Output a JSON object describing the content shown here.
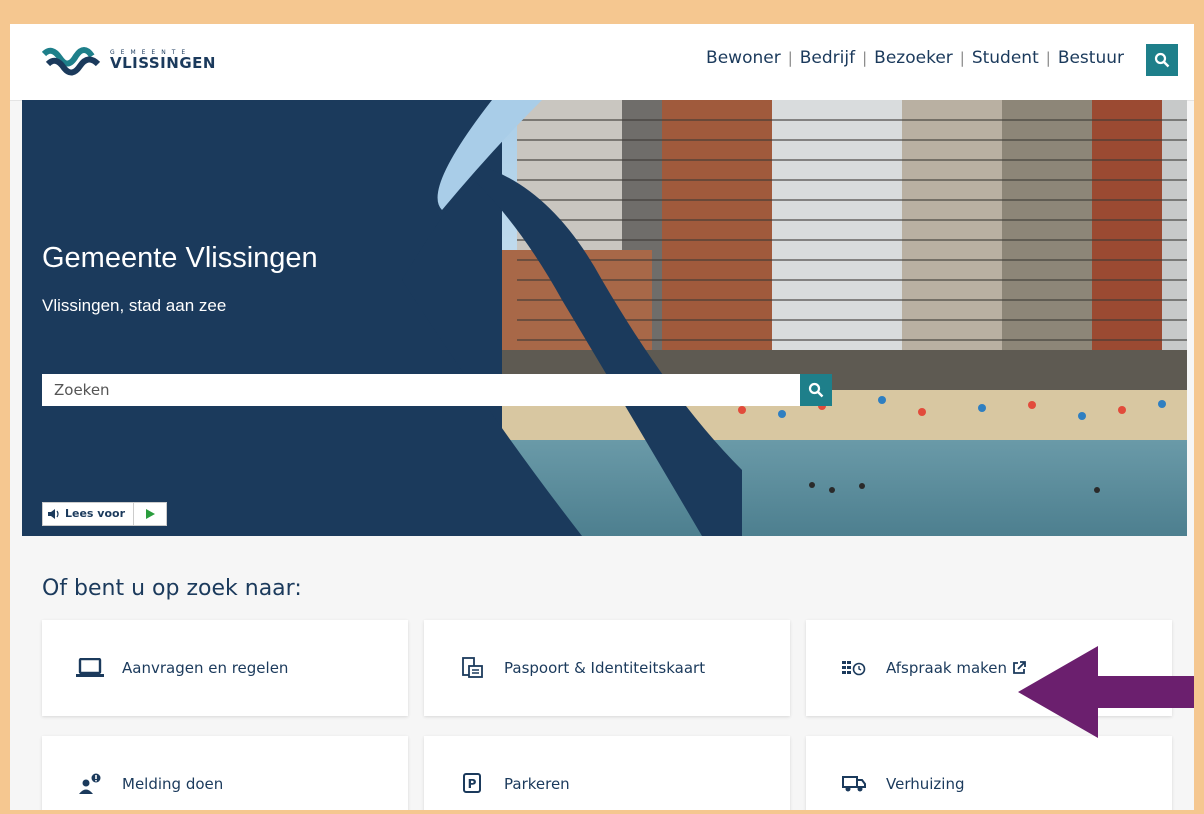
{
  "header": {
    "logo_small": "GEMEENTE",
    "logo_big": "VLISSINGEN",
    "nav": [
      "Bewoner",
      "Bedrijf",
      "Bezoeker",
      "Student",
      "Bestuur"
    ],
    "search_icon": "search-icon"
  },
  "hero": {
    "title": "Gemeente Vlissingen",
    "subtitle": "Vlissingen, stad aan zee",
    "search_placeholder": "Zoeken",
    "readspeaker_label": "Lees voor"
  },
  "section": {
    "title": "Of bent u op zoek naar:",
    "cards": [
      {
        "label": "Aanvragen en regelen",
        "icon": "laptop-icon"
      },
      {
        "label": "Paspoort & Identiteitskaart",
        "icon": "id-card-icon"
      },
      {
        "label": "Afspraak maken",
        "icon": "calendar-clock-icon"
      },
      {
        "label": "Melding doen",
        "icon": "person-alert-icon"
      },
      {
        "label": "Parkeren",
        "icon": "parking-icon"
      },
      {
        "label": "Verhuizing",
        "icon": "moving-truck-icon"
      }
    ]
  },
  "colors": {
    "brand": "#1b3a5c",
    "accent": "#1e7f8a",
    "border": "#f5c790",
    "arrow": "#6b1f6e"
  }
}
